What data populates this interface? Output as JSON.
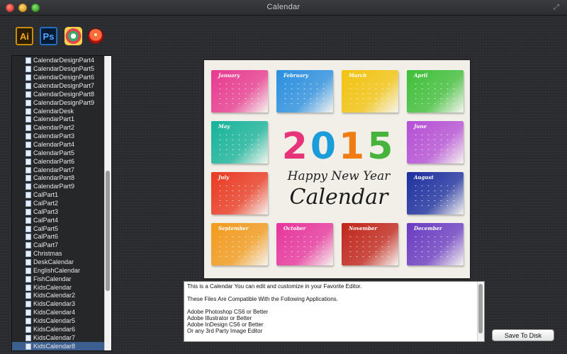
{
  "window": {
    "title": "Calendar"
  },
  "toolbar": {
    "icons": [
      {
        "name": "illustrator-icon",
        "glyph": "Ai"
      },
      {
        "name": "photoshop-icon",
        "glyph": "Ps"
      },
      {
        "name": "calendar-app-icon",
        "glyph": ""
      },
      {
        "name": "browser-icon",
        "glyph": ""
      }
    ]
  },
  "sidebar": {
    "items": [
      "CalendarDesignPart4",
      "CalendarDesignPart5",
      "CalendarDesignPart6",
      "CalendarDesignPart7",
      "CalendarDesignPart8",
      "CalendarDesignPart9",
      "CalendarDesk",
      "CalendarPart1",
      "CalendarPart2",
      "CalendarPart3",
      "CalendarPart4",
      "CalendarPart5",
      "CalendarPart6",
      "CalendarPart7",
      "CalendarPart8",
      "CalendarPart9",
      "CalPart1",
      "CalPart2",
      "CalPart3",
      "CalPart4",
      "CalPart5",
      "CalPart6",
      "CalPart7",
      "Christmas",
      "DeskCalendar",
      "EnglishCalendar",
      "FishCalendar",
      "KidsCalendar",
      "KidsCalendar2",
      "KidsCalendar3",
      "KidsCalendar4",
      "KidsCalendar5",
      "KidsCalendar6",
      "KidsCalendar7",
      "KidsCalendar8"
    ],
    "selected_index": 34
  },
  "preview": {
    "year": [
      "2",
      "0",
      "1",
      "5"
    ],
    "greeting": "Happy New Year",
    "subtitle": "Calendar",
    "months": [
      {
        "name": "January",
        "color": "#e8398f"
      },
      {
        "name": "February",
        "color": "#2a8fe0"
      },
      {
        "name": "March",
        "color": "#f2c30f"
      },
      {
        "name": "April",
        "color": "#3fbf3a"
      },
      {
        "name": "May",
        "color": "#17b39a"
      },
      {
        "name": "June",
        "color": "#b54fd6"
      },
      {
        "name": "July",
        "color": "#ea3a22"
      },
      {
        "name": "August",
        "color": "#1d2f9f"
      },
      {
        "name": "September",
        "color": "#f29a1c"
      },
      {
        "name": "October",
        "color": "#e7349c"
      },
      {
        "name": "November",
        "color": "#c0251b"
      },
      {
        "name": "December",
        "color": "#6a3bc2"
      }
    ]
  },
  "description": {
    "text": "This is a Calendar You can edit and customize in your Favorite Editor.\n\nThese Files Are Compatible With the Following Applications.\n\nAdobe Photoshop CS6 or Better\nAdobe Illustrator or Better\nAdobe InDesign CS6 or Better\nOr any 3rd Party Image Editor"
  },
  "actions": {
    "save_label": "Save To Disk"
  }
}
